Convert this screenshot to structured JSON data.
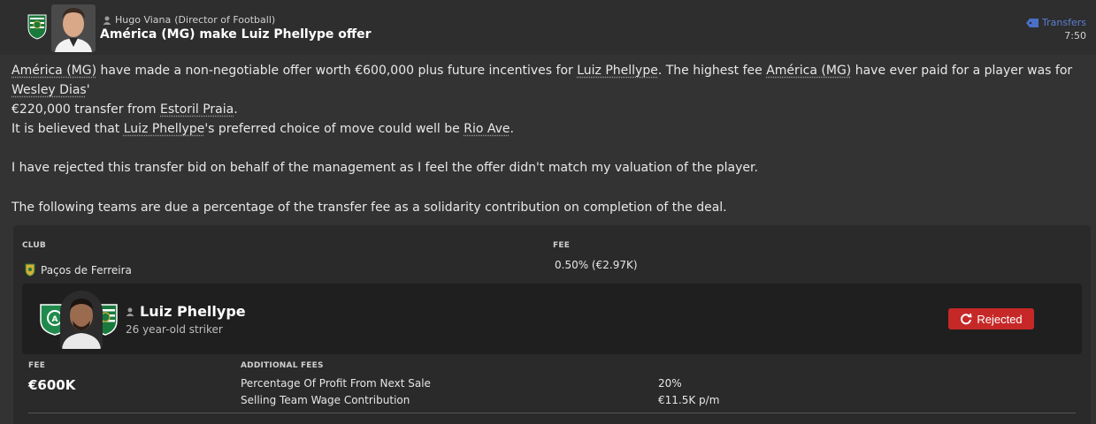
{
  "header": {
    "sender_name": "Hugo Viana",
    "sender_role": "(Director of Football)",
    "title": "América (MG) make Luiz Phellype offer",
    "category": "Transfers",
    "time": "7:50",
    "icons": {
      "club": "sporting-crest-icon",
      "sender": "person-icon",
      "category": "tag-icon"
    }
  },
  "message": {
    "p1": {
      "club1": "América (MG)",
      "t1": " have made a non-negotiable offer worth €600,000 plus future incentives for ",
      "player": "Luiz Phellype",
      "t2": ". The highest fee ",
      "club2": "América (MG)",
      "t3": " have ever paid for a player was for ",
      "prev_player": "Wesley Dias",
      "t4": "' ",
      "t5": "€220,000 transfer from ",
      "prev_club": "Estoril Praia",
      "t6": "."
    },
    "p2": {
      "t1": "It is believed that ",
      "player": "Luiz Phellype",
      "t2": "'s preferred choice of move could well be ",
      "club": "Rio Ave",
      "t3": "."
    },
    "p3": "I have rejected this transfer bid on behalf of the management as I feel the offer didn't match my valuation of the player.",
    "p4": "The following teams are due a percentage of the transfer fee as a solidarity contribution on completion of the deal."
  },
  "solidarity": {
    "club_header": "CLUB",
    "fee_header": "FEE",
    "rows": [
      {
        "club": "Paços de Ferreira",
        "fee": "0.50% (€2.97K)"
      }
    ]
  },
  "player_card": {
    "name": "Luiz Phellype",
    "description": "26 year-old striker",
    "status": "Rejected",
    "status_color": "#c62828",
    "fee_label": "FEE",
    "fee": "€600K",
    "additional_fees_label": "ADDITIONAL FEES",
    "additional_fees": [
      {
        "label": "Percentage Of Profit From Next Sale",
        "value": "20%"
      },
      {
        "label": "Selling Team Wage Contribution",
        "value": "€11.5K p/m"
      }
    ]
  },
  "colors": {
    "link": "#5b7fd4",
    "rejected": "#c62828",
    "background": "#333333",
    "card": "#1f1f1f"
  }
}
